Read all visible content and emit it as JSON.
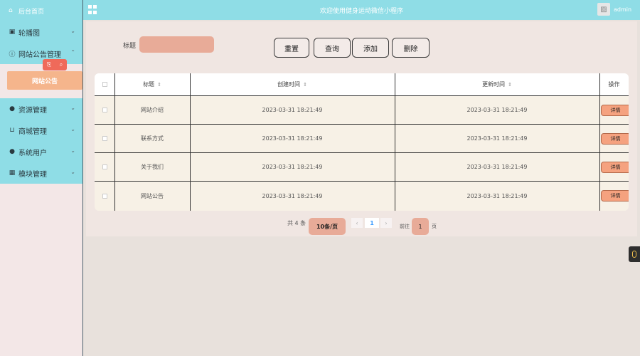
{
  "sidebar": {
    "home": "后台首页",
    "items": [
      {
        "label": "轮播图",
        "icon": "image-icon"
      },
      {
        "label": "网站公告管理",
        "icon": "info-icon"
      },
      {
        "label": "资源管理",
        "icon": "pin-icon"
      },
      {
        "label": "商城管理",
        "icon": "cart-icon"
      },
      {
        "label": "系统用户",
        "icon": "user-icon"
      },
      {
        "label": "模块管理",
        "icon": "grid-icon"
      }
    ],
    "active_sub": "网站公告"
  },
  "header": {
    "title": "欢迎使用健身运动微信小程序",
    "user": "admin"
  },
  "search": {
    "label": "标题",
    "placeholder": ""
  },
  "buttons": {
    "reset": "重置",
    "query": "查询",
    "add": "添加",
    "delete": "删除"
  },
  "table": {
    "headers": [
      "标题",
      "创建时间",
      "更新时间",
      "操作"
    ],
    "rows": [
      {
        "title": "网站介绍",
        "created": "2023-03-31 18:21:49",
        "updated": "2023-03-31 18:21:49",
        "action": "详情"
      },
      {
        "title": "联系方式",
        "created": "2023-03-31 18:21:49",
        "updated": "2023-03-31 18:21:49",
        "action": "详情"
      },
      {
        "title": "关于我们",
        "created": "2023-03-31 18:21:49",
        "updated": "2023-03-31 18:21:49",
        "action": "详情"
      },
      {
        "title": "网站公告",
        "created": "2023-03-31 18:21:49",
        "updated": "2023-03-31 18:21:49",
        "action": "详情"
      }
    ]
  },
  "pagination": {
    "total": "共 4 条",
    "page_size": "10条/页",
    "current": "1",
    "goto_prefix": "前往",
    "goto_value": "1",
    "goto_suffix": "页"
  }
}
